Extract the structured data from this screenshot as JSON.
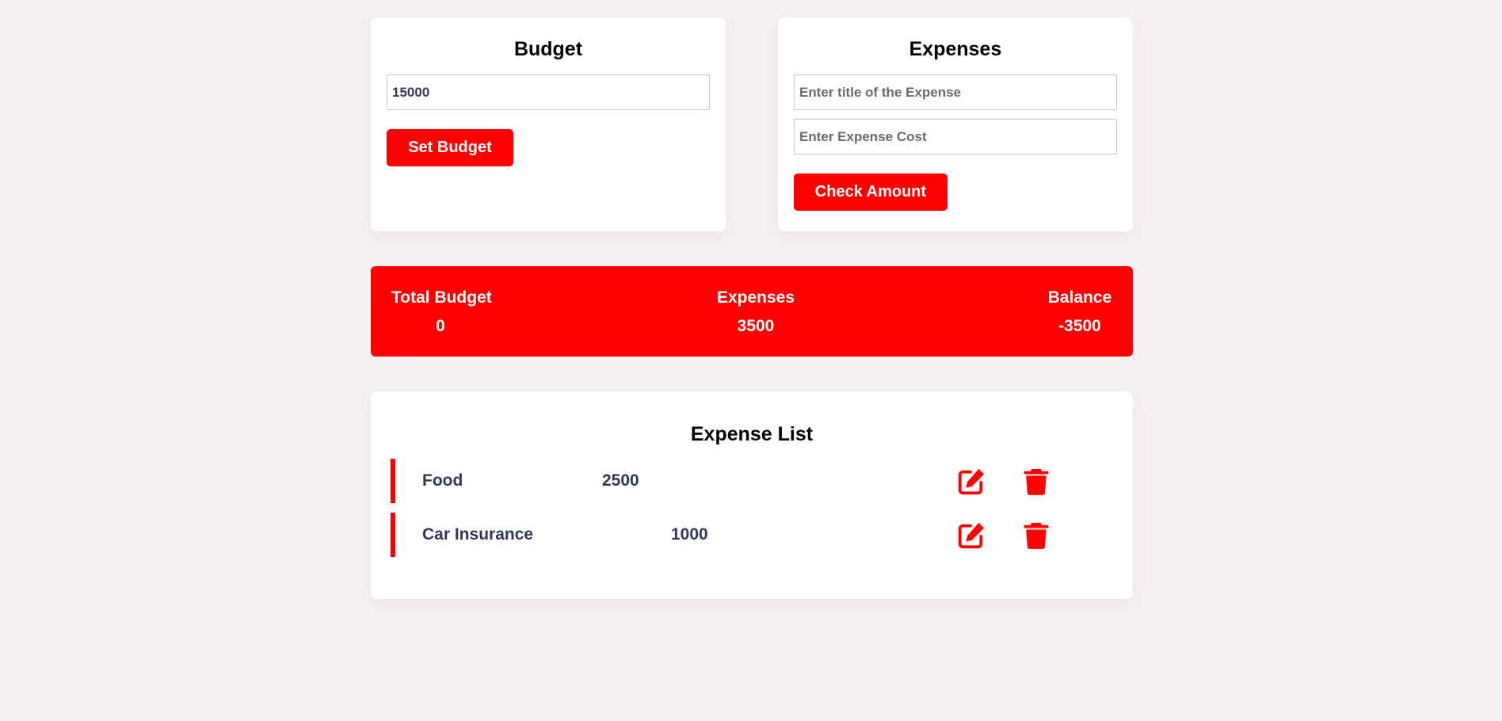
{
  "budget_card": {
    "title": "Budget",
    "input_value": "15000",
    "button_label": "Set Budget"
  },
  "expenses_card": {
    "title": "Expenses",
    "title_placeholder": "Enter title of the Expense",
    "cost_placeholder": "Enter Expense Cost",
    "button_label": "Check Amount"
  },
  "summary": {
    "total_budget_label": "Total Budget",
    "total_budget_value": "0",
    "expenses_label": "Expenses",
    "expenses_value": "3500",
    "balance_label": "Balance",
    "balance_value": "-3500"
  },
  "expense_list": {
    "title": "Expense List",
    "items": [
      {
        "title": "Food",
        "amount": "2500",
        "edit_icon": "edit-icon",
        "delete_icon": "trash-icon"
      },
      {
        "title": "Car Insurance",
        "amount": "1000",
        "edit_icon": "edit-icon",
        "delete_icon": "trash-icon"
      }
    ]
  },
  "colors": {
    "accent": "#ff0000",
    "background": "#f7f0f0",
    "card": "#ffffff",
    "text_dark": "#2e3a55"
  }
}
